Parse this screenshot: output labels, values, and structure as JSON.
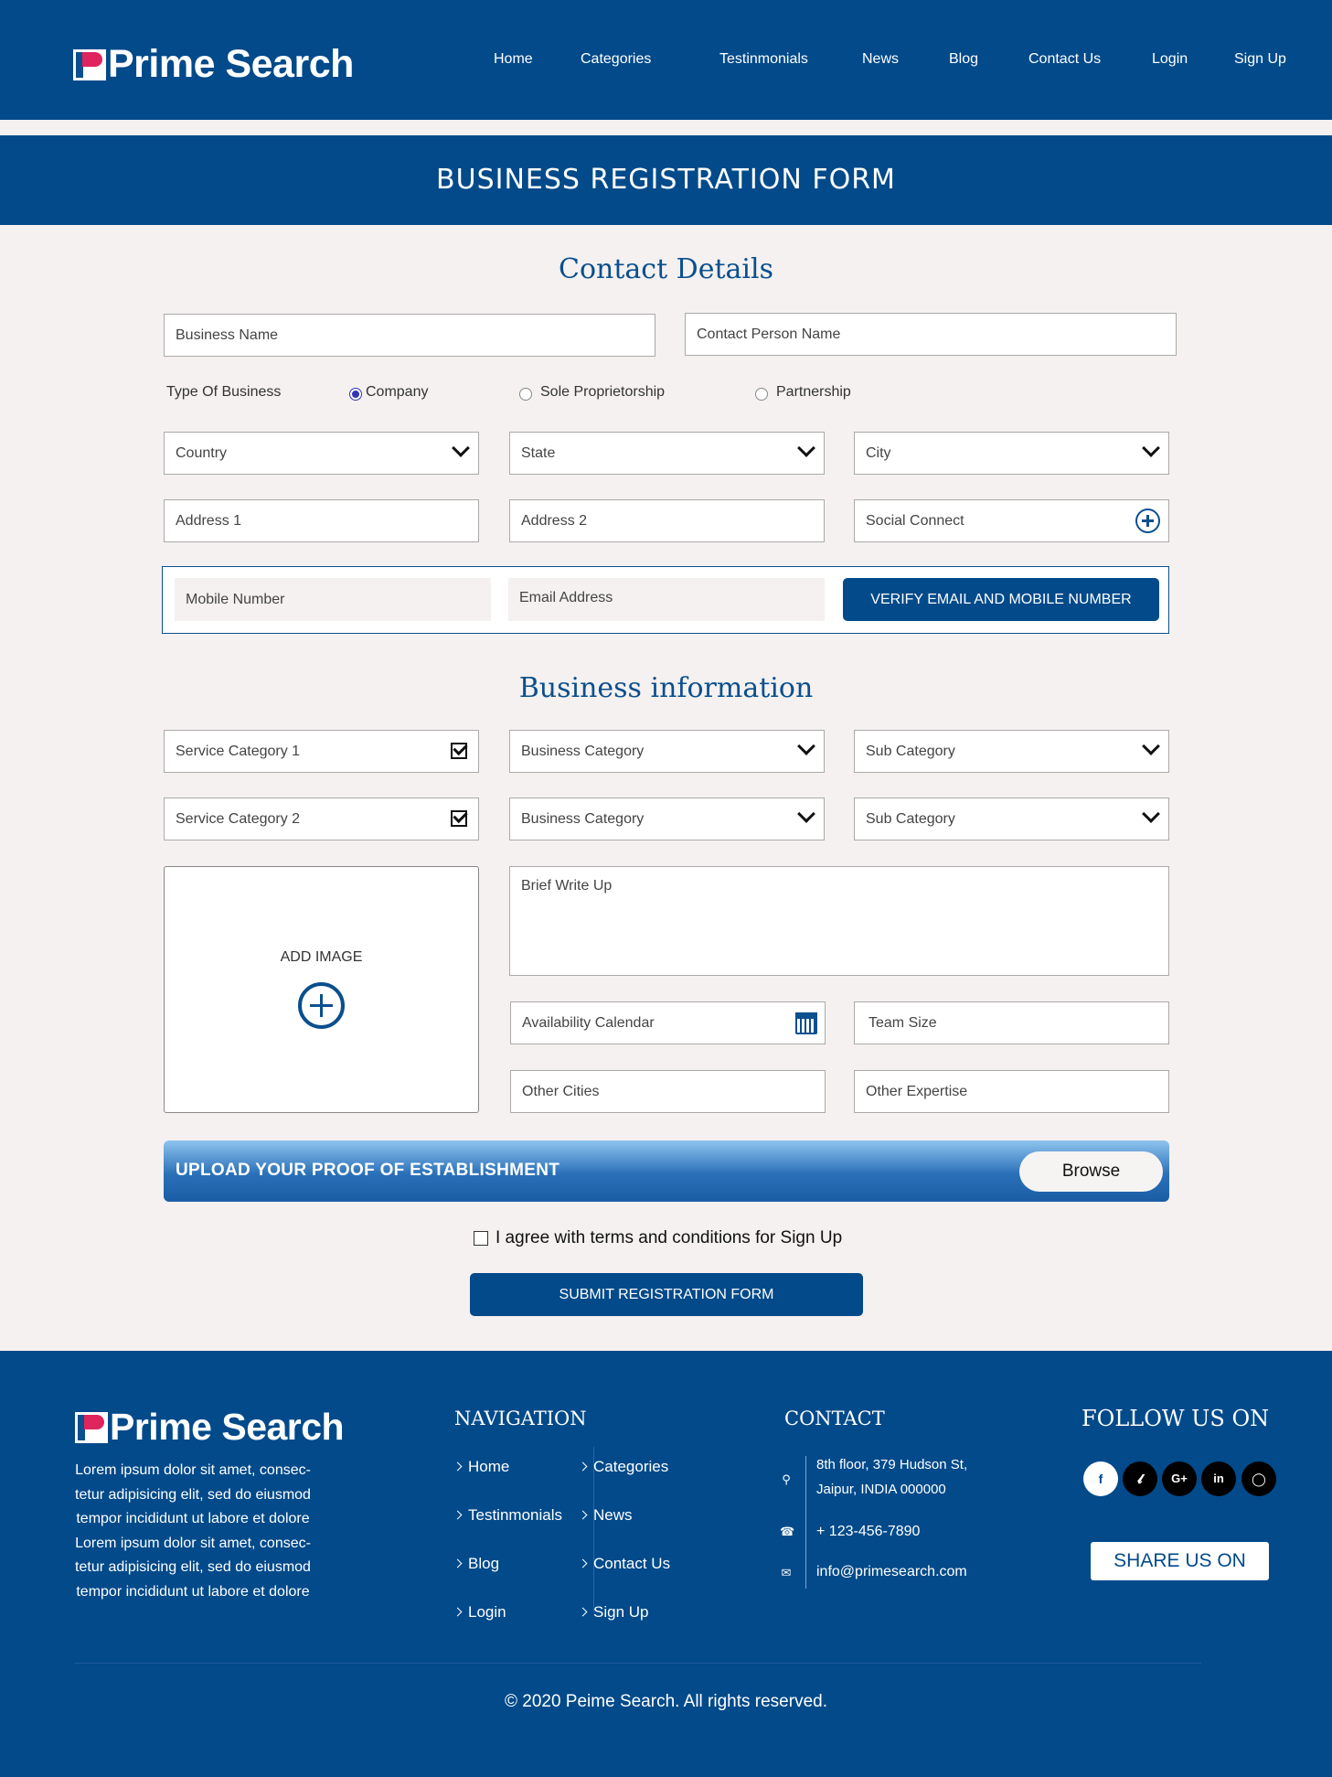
{
  "header": {
    "brand": "Prime Search",
    "nav": [
      "Home",
      "Categories",
      "Testinmonials",
      "News",
      "Blog",
      "Contact Us",
      "Login",
      "Sign Up"
    ]
  },
  "banner": {
    "title": "BUSINESS REGISTRATION FORM"
  },
  "contact": {
    "title": "Contact Details",
    "business_name": "Business Name",
    "contact_person": "Contact Person Name",
    "type_label": "Type Of Business",
    "types": [
      "Company",
      "Sole Proprietorship",
      "Partnership"
    ],
    "selected_type": "Company",
    "country": "Country",
    "state": "State",
    "city": "City",
    "address1": "Address 1",
    "address2": "Address 2",
    "social": "Social Connect",
    "mobile": "Mobile Number",
    "email": "Email Address",
    "verify_button": "VERIFY EMAIL AND MOBILE NUMBER"
  },
  "business": {
    "title": "Business information",
    "service1": "Service Category 1",
    "service2": "Service Category 2",
    "business_category": "Business Category",
    "sub_category": "Sub Category",
    "add_image": "ADD IMAGE",
    "write_up": "Brief Write Up",
    "calendar": "Availability Calendar",
    "team_size": "Team Size",
    "other_cities": "Other Cities",
    "other_expertise": "Other Expertise",
    "upload_label": "UPLOAD YOUR PROOF OF ESTABLISHMENT",
    "browse": "Browse",
    "agree": "I agree with terms and conditions for Sign Up",
    "submit": "SUBMIT REGISTRATION FORM"
  },
  "footer": {
    "brand": "Prime Search",
    "about_lines": [
      "Lorem ipsum dolor sit amet, consec-",
      "tetur adipisicing elit, sed do eiusmod",
      "tempor incididunt ut labore et dolore",
      "Lorem ipsum dolor sit amet, consec-",
      "tetur adipisicing elit, sed do eiusmod",
      "tempor incididunt ut labore et dolore"
    ],
    "nav_title": "NAVIGATION",
    "nav_left": [
      "Home",
      "Testinmonials",
      "Blog",
      "Login"
    ],
    "nav_right": [
      "Categories",
      "News",
      "Contact Us",
      "Sign Up"
    ],
    "contact_title": "CONTACT",
    "address_line1": "8th floor, 379 Hudson St,",
    "address_line2": "Jaipur, INDIA 000000",
    "phone": "+ 123-456-7890",
    "email": "info@primesearch.com",
    "follow_title": "FOLLOW US ON",
    "social_icons": [
      "facebook-icon",
      "twitter-icon",
      "google-plus-icon",
      "linkedin-icon",
      "instagram-icon"
    ],
    "share": "SHARE US ON",
    "copyright": "© 2020  Peime Search. All rights reserved."
  },
  "colors": {
    "primary": "#024a8a",
    "background": "#f4f1f0",
    "radio": "#3436b0"
  }
}
